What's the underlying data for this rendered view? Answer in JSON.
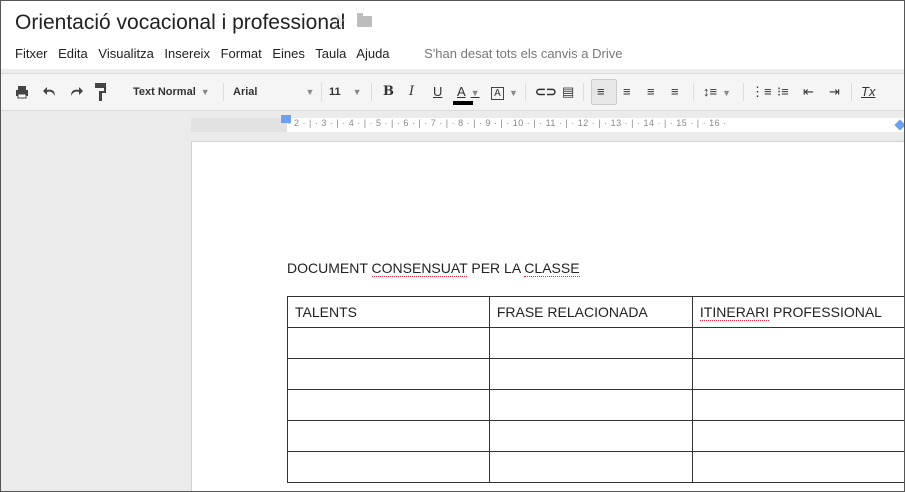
{
  "document": {
    "title": "Orientació vocacional i professional",
    "star_icon": "star-icon",
    "folder_icon": "folder-icon"
  },
  "menu": {
    "items": [
      "Fitxer",
      "Edita",
      "Visualitza",
      "Insereix",
      "Format",
      "Eines",
      "Taula",
      "Ajuda"
    ],
    "status": "S'han desat tots els canvis a Drive"
  },
  "toolbar": {
    "style": "Text Normal",
    "font": "Arial",
    "size": "11",
    "bold": "B",
    "italic": "I",
    "underline": "U",
    "text_color": "A",
    "highlight": "A",
    "text_color_bar": "#000000"
  },
  "ruler": {
    "labels": "· 2 · | · 1 · | · ▾ · 1 · | · 2 · | · 3 · | · 4 · | · 5 · | · 6 · | · 7 · | · 8 · | · 9 · | · 10 · | · 11 · | · 12 · | · 13 · | · 14 · | · 15 · | · 16 ·"
  },
  "content": {
    "heading_part1": "DOCUMENT ",
    "heading_part2": "CONSENSUAT",
    "heading_part3": " PER LA ",
    "heading_part4": "CLASSE",
    "table": {
      "headers": [
        "TALENTS",
        "FRASE RELACIONADA",
        "ITINERARI",
        " PROFESSIONAL"
      ],
      "rows": [
        [
          "",
          "",
          ""
        ],
        [
          "",
          "",
          ""
        ],
        [
          "",
          "",
          ""
        ],
        [
          "",
          "",
          ""
        ],
        [
          "",
          "",
          ""
        ]
      ]
    }
  }
}
